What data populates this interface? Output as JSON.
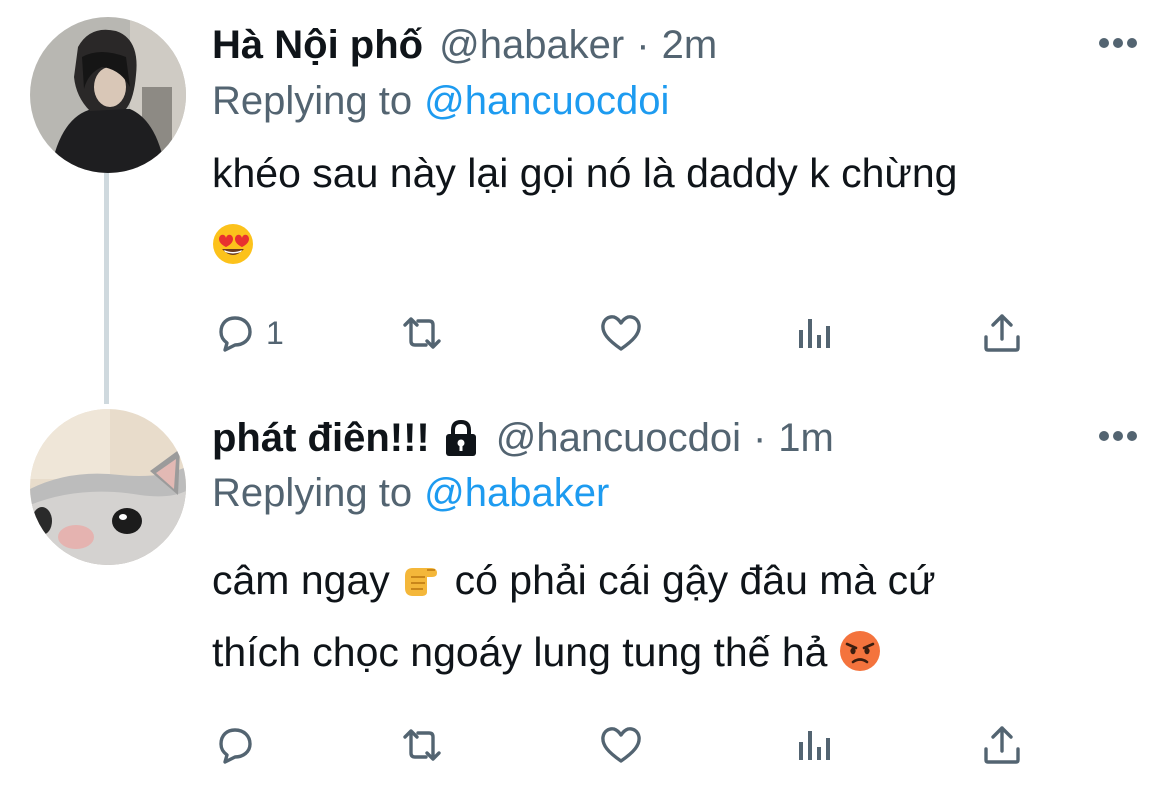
{
  "tweets": [
    {
      "name": "Hà Nội phố",
      "handle": "@habaker",
      "separator": "·",
      "time": "2m",
      "replying_label": "Replying to",
      "replying_to": "@hancuocdoi",
      "text": "khéo sau này lại gọi nó là daddy k chừng",
      "emoji": [
        "smiling-face-with-heart-eyes"
      ],
      "locked": false,
      "reply_count": "1"
    },
    {
      "name": "phát điên!!!",
      "handle": "@hancuocdoi",
      "separator": "·",
      "time": "1m",
      "replying_label": "Replying to",
      "replying_to": "@habaker",
      "text_part1": "câm ngay",
      "text_part2": "có phải cái gậy đâu mà cứ",
      "text_line2": "thích chọc ngoáy lung tung thế hả",
      "emoji": [
        "backhand-pointing-right",
        "pouting-face"
      ],
      "locked": true,
      "reply_count": ""
    }
  ],
  "colors": {
    "text": "#0f1419",
    "secondary": "#536471",
    "link": "#1d9bf0",
    "thread_line": "#cfd9de"
  },
  "icons": [
    "more-icon",
    "lock-icon",
    "reply-icon",
    "retweet-icon",
    "like-icon",
    "views-icon",
    "share-icon"
  ]
}
